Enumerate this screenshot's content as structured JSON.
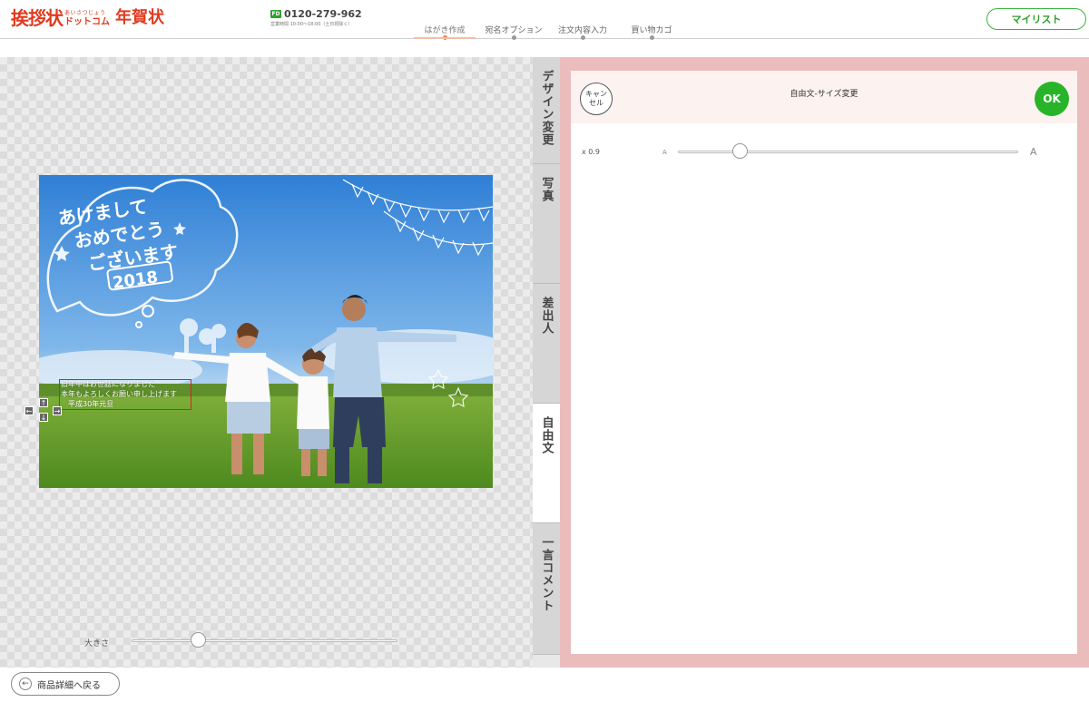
{
  "header": {
    "logo_main": "挨拶状",
    "logo_ruby": "あいさつじょう",
    "logo_dotcom": "ドットコム",
    "logo_product": "年賀状",
    "phone_icon": "freedial-icon",
    "phone_icon_text": "FD",
    "phone_number": "0120-279-962",
    "phone_hours": "営業時間 10:00～18:00（土日祝除く）",
    "steps": [
      {
        "label": "はがき作成",
        "active": true
      },
      {
        "label": "宛名オプション",
        "active": false
      },
      {
        "label": "注文内容入力",
        "active": false
      },
      {
        "label": "買い物カゴ",
        "active": false
      }
    ],
    "mylist_label": "マイリスト"
  },
  "card": {
    "art_text": [
      "あけまして",
      "おめでとう",
      "ございます"
    ],
    "art_year": "2018",
    "greeting_lines": [
      "旧年中はお世話になりました",
      "本年もよろしくお願い申し上げます",
      "　平成30年元旦"
    ],
    "handle_icons": [
      "arrow-up-icon",
      "arrow-left-icon",
      "arrow-down-icon",
      "arrow-right-icon"
    ],
    "handle_glyphs": {
      "up": "↑",
      "left": "←",
      "down": "↓",
      "right": "→"
    }
  },
  "canvas_size": {
    "label": "大きさ",
    "value": 0.25
  },
  "tabs": [
    {
      "label": "デザイン変更",
      "active": false
    },
    {
      "label": "写真",
      "active": false
    },
    {
      "label": "差出人",
      "active": false
    },
    {
      "label": "自由文",
      "active": true
    },
    {
      "label": "一言コメント",
      "active": false
    }
  ],
  "panel": {
    "cancel_label": "キャン\nセル",
    "title": "自由文-サイズ変更",
    "ok_label": "OK",
    "scale_label": "x 0.9",
    "small_a": "A",
    "big_a": "A",
    "slider_value": 0.18
  },
  "footer": {
    "back_label": "商品詳細へ戻る",
    "back_icon": "arrow-left-circle-icon",
    "back_glyph": "←"
  },
  "colors": {
    "brand_red": "#e03a1e",
    "accent_green": "#28b428",
    "panel_pink": "#ebbcbc",
    "selection_red": "#e02020"
  }
}
